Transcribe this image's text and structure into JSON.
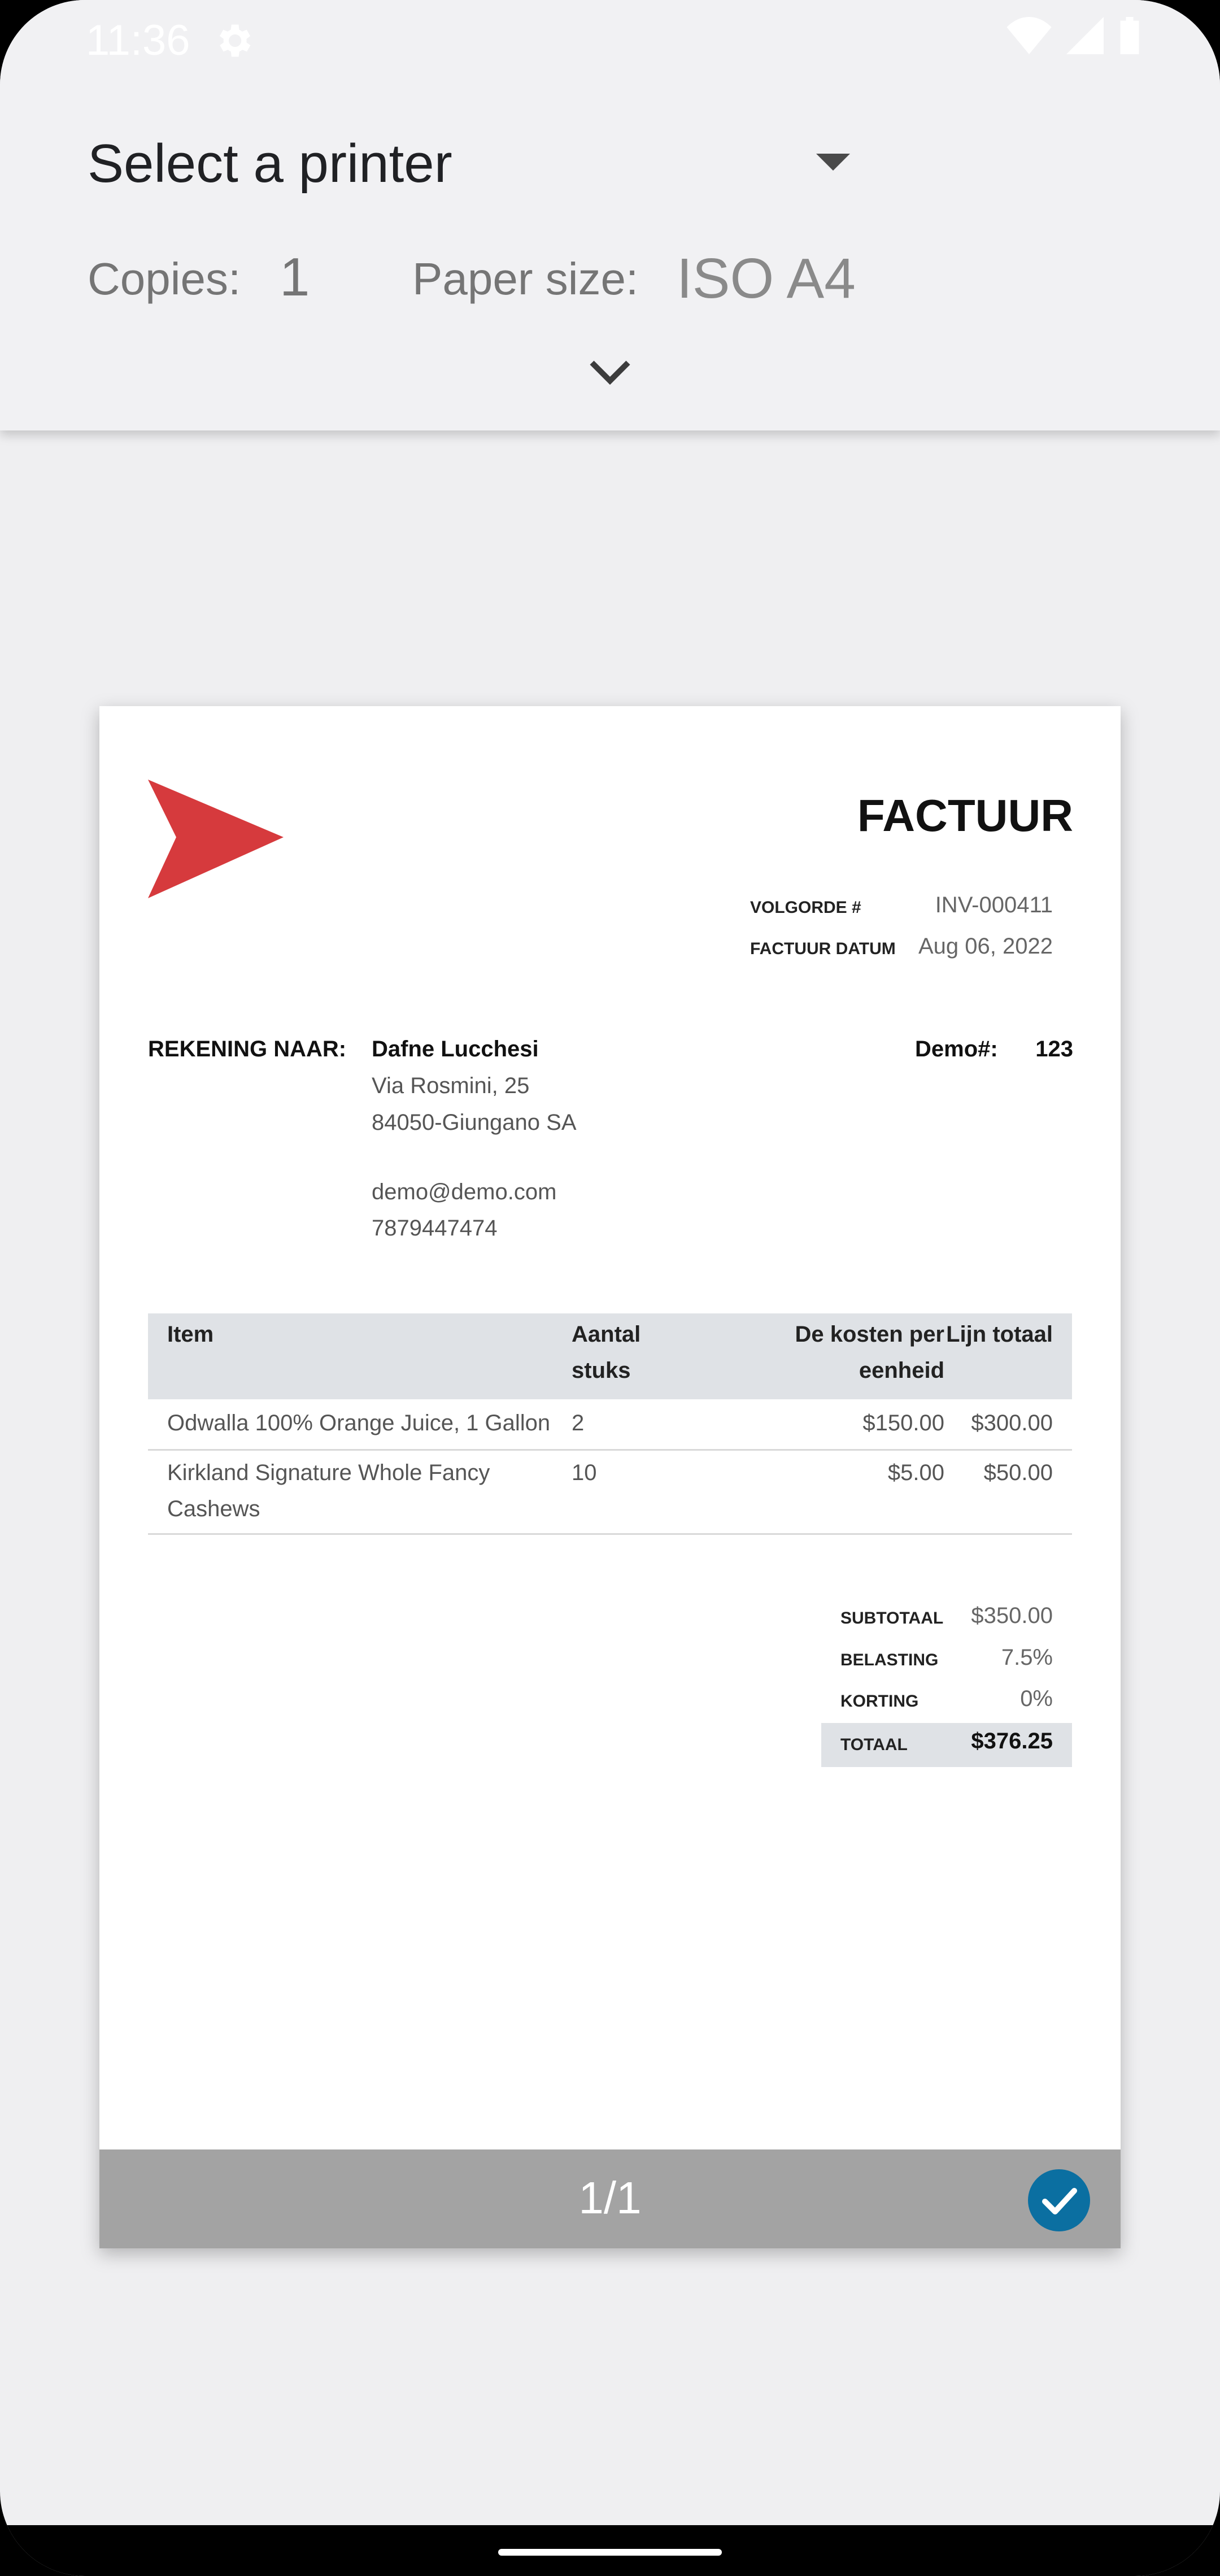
{
  "status": {
    "time": "11:36"
  },
  "print_dialog": {
    "printer_select": "Select a printer",
    "copies_label": "Copies:",
    "copies_value": "1",
    "paper_label": "Paper size:",
    "paper_value": "ISO A4"
  },
  "invoice": {
    "title": "FACTUUR",
    "meta": [
      {
        "key": "VOLGORDE #",
        "value": "INV-000411"
      },
      {
        "key": "FACTUUR DATUM",
        "value": "Aug 06, 2022"
      }
    ],
    "bill_label": "REKENING NAAR:",
    "bill_to": {
      "name": "Dafne Lucchesi",
      "street": "Via Rosmini, 25",
      "city": "84050-Giungano SA",
      "email": "demo@demo.com",
      "phone": "7879447474"
    },
    "demo_label": "Demo#:",
    "demo_value": "123",
    "columns": {
      "item": "Item",
      "qty_1": "Aantal",
      "qty_2": "stuks",
      "unit_1": "De kosten per",
      "unit_2": "eenheid",
      "total": "Lijn totaal"
    },
    "rows": [
      {
        "item_1": "Odwalla 100% Orange Juice, 1 Gallon",
        "item_2": "",
        "qty": "2",
        "unit": "$150.00",
        "total": "$300.00"
      },
      {
        "item_1": "Kirkland Signature Whole Fancy",
        "item_2": "Cashews",
        "qty": "10",
        "unit": "$5.00",
        "total": "$50.00"
      }
    ],
    "totals": [
      {
        "key": "SUBTOTAAL",
        "value": "$350.00"
      },
      {
        "key": "BELASTING",
        "value": "7.5%"
      },
      {
        "key": "KORTING",
        "value": "0%"
      },
      {
        "key": "TOTAAL",
        "value": "$376.25"
      }
    ]
  },
  "preview": {
    "page_counter": "1/1"
  },
  "colors": {
    "logo": "#d63a3d",
    "check": "#0b6fa1",
    "table_header": "#dfe2e6"
  }
}
